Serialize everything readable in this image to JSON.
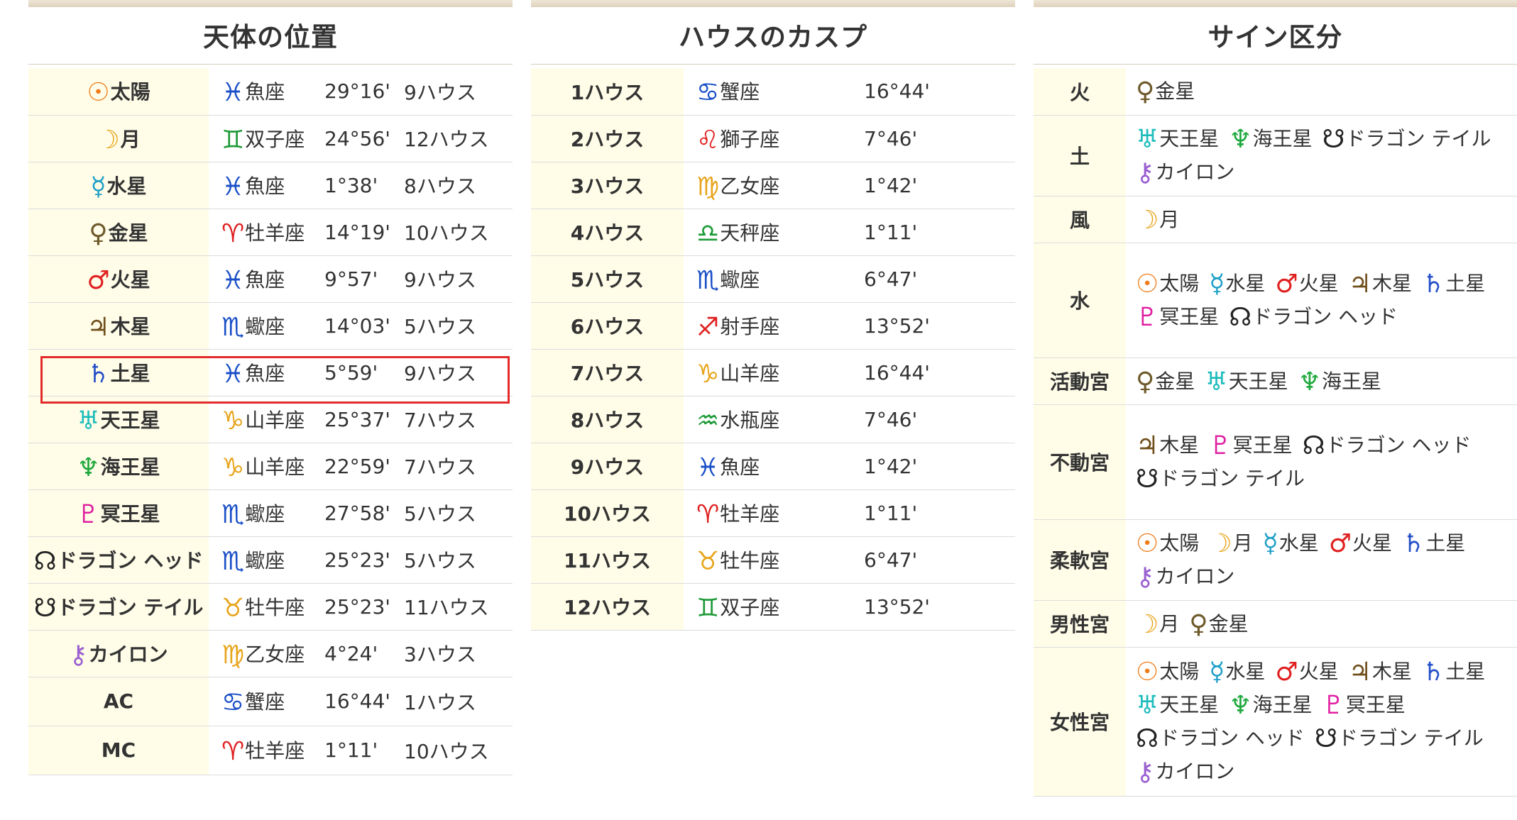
{
  "colors": {
    "sun": "#ef7d1a",
    "moon": "#e8a51d",
    "mercury": "#1e9fc7",
    "venus": "#6e5a2a",
    "mars": "#e02020",
    "jupiter": "#6f4e1a",
    "saturn": "#2450c8",
    "uranus": "#1ebcbc",
    "neptune": "#1ea83c",
    "pluto": "#e01ea0",
    "node": "#222222",
    "chiron": "#9a5fd0",
    "water": "#1a4fc7",
    "earth": "#e8a51d",
    "fire": "#e02020",
    "air": "#1e9a38",
    "label_bg": "#fffde8"
  },
  "positions": {
    "title": "天体の位置",
    "rows": [
      {
        "sym": "☉",
        "sym_icon": "sun-icon",
        "sym_color": "#ef7d1a",
        "label": "太陽",
        "sign_sym": "♓",
        "sign_icon": "pisces-icon",
        "sign_color": "#1a4fc7",
        "sign": "魚座",
        "deg": "29°16'",
        "house": "9ハウス"
      },
      {
        "sym": "☽",
        "sym_icon": "moon-icon",
        "sym_color": "#e8a51d",
        "label": "月",
        "sign_sym": "♊",
        "sign_icon": "gemini-icon",
        "sign_color": "#1e9a38",
        "sign": "双子座",
        "deg": "24°56'",
        "house": "12ハウス"
      },
      {
        "sym": "☿",
        "sym_icon": "mercury-icon",
        "sym_color": "#1e9fc7",
        "label": "水星",
        "sign_sym": "♓",
        "sign_icon": "pisces-icon",
        "sign_color": "#1a4fc7",
        "sign": "魚座",
        "deg": "1°38'",
        "house": "8ハウス"
      },
      {
        "sym": "♀",
        "sym_icon": "venus-icon",
        "sym_color": "#6e5a2a",
        "label": "金星",
        "sign_sym": "♈",
        "sign_icon": "aries-icon",
        "sign_color": "#e02020",
        "sign": "牡羊座",
        "deg": "14°19'",
        "house": "10ハウス"
      },
      {
        "sym": "♂",
        "sym_icon": "mars-icon",
        "sym_color": "#e02020",
        "label": "火星",
        "sign_sym": "♓",
        "sign_icon": "pisces-icon",
        "sign_color": "#1a4fc7",
        "sign": "魚座",
        "deg": "9°57'",
        "house": "9ハウス"
      },
      {
        "sym": "♃",
        "sym_icon": "jupiter-icon",
        "sym_color": "#6f4e1a",
        "label": "木星",
        "sign_sym": "♏",
        "sign_icon": "scorpio-icon",
        "sign_color": "#1a4fc7",
        "sign": "蠍座",
        "deg": "14°03'",
        "house": "5ハウス"
      },
      {
        "sym": "♄",
        "sym_icon": "saturn-icon",
        "sym_color": "#2450c8",
        "label": "土星",
        "sign_sym": "♓",
        "sign_icon": "pisces-icon",
        "sign_color": "#1a4fc7",
        "sign": "魚座",
        "deg": "5°59'",
        "house": "9ハウス"
      },
      {
        "sym": "♅",
        "sym_icon": "uranus-icon",
        "sym_color": "#1ebcbc",
        "label": "天王星",
        "sign_sym": "♑",
        "sign_icon": "capricorn-icon",
        "sign_color": "#e8a51d",
        "sign": "山羊座",
        "deg": "25°37'",
        "house": "7ハウス"
      },
      {
        "sym": "♆",
        "sym_icon": "neptune-icon",
        "sym_color": "#1ea83c",
        "label": "海王星",
        "sign_sym": "♑",
        "sign_icon": "capricorn-icon",
        "sign_color": "#e8a51d",
        "sign": "山羊座",
        "deg": "22°59'",
        "house": "7ハウス"
      },
      {
        "sym": "♇",
        "sym_icon": "pluto-icon",
        "sym_color": "#e01ea0",
        "label": "冥王星",
        "sign_sym": "♏",
        "sign_icon": "scorpio-icon",
        "sign_color": "#1a4fc7",
        "sign": "蠍座",
        "deg": "27°58'",
        "house": "5ハウス"
      },
      {
        "sym": "☊",
        "sym_icon": "dragon-head-icon",
        "sym_color": "#222222",
        "label": "ドラゴン ヘッド",
        "sign_sym": "♏",
        "sign_icon": "scorpio-icon",
        "sign_color": "#1a4fc7",
        "sign": "蠍座",
        "deg": "25°23'",
        "house": "5ハウス"
      },
      {
        "sym": "☋",
        "sym_icon": "dragon-tail-icon",
        "sym_color": "#222222",
        "label": "ドラゴン テイル",
        "sign_sym": "♉",
        "sign_icon": "taurus-icon",
        "sign_color": "#e8a51d",
        "sign": "牡牛座",
        "deg": "25°23'",
        "house": "11ハウス"
      },
      {
        "sym": "⚷",
        "sym_icon": "chiron-icon",
        "sym_color": "#9a5fd0",
        "label": "カイロン",
        "sign_sym": "♍",
        "sign_icon": "virgo-icon",
        "sign_color": "#e8a51d",
        "sign": "乙女座",
        "deg": "4°24'",
        "house": "3ハウス"
      },
      {
        "sym": "",
        "sym_icon": "",
        "sym_color": "#333333",
        "label": "AC",
        "sign_sym": "♋",
        "sign_icon": "cancer-icon",
        "sign_color": "#1a4fc7",
        "sign": "蟹座",
        "deg": "16°44'",
        "house": "1ハウス"
      },
      {
        "sym": "",
        "sym_icon": "",
        "sym_color": "#333333",
        "label": "MC",
        "sign_sym": "♈",
        "sign_icon": "aries-icon",
        "sign_color": "#e02020",
        "sign": "牡羊座",
        "deg": "1°11'",
        "house": "10ハウス"
      }
    ]
  },
  "cusps": {
    "title": "ハウスのカスプ",
    "rows": [
      {
        "label": "1ハウス",
        "sign_sym": "♋",
        "sign_icon": "cancer-icon",
        "sign_color": "#1a4fc7",
        "sign": "蟹座",
        "deg": "16°44'"
      },
      {
        "label": "2ハウス",
        "sign_sym": "♌",
        "sign_icon": "leo-icon",
        "sign_color": "#e02020",
        "sign": "獅子座",
        "deg": "7°46'"
      },
      {
        "label": "3ハウス",
        "sign_sym": "♍",
        "sign_icon": "virgo-icon",
        "sign_color": "#e8a51d",
        "sign": "乙女座",
        "deg": "1°42'"
      },
      {
        "label": "4ハウス",
        "sign_sym": "♎",
        "sign_icon": "libra-icon",
        "sign_color": "#1e9a38",
        "sign": "天秤座",
        "deg": "1°11'"
      },
      {
        "label": "5ハウス",
        "sign_sym": "♏",
        "sign_icon": "scorpio-icon",
        "sign_color": "#1a4fc7",
        "sign": "蠍座",
        "deg": "6°47'"
      },
      {
        "label": "6ハウス",
        "sign_sym": "♐",
        "sign_icon": "sagittarius-icon",
        "sign_color": "#e02020",
        "sign": "射手座",
        "deg": "13°52'"
      },
      {
        "label": "7ハウス",
        "sign_sym": "♑",
        "sign_icon": "capricorn-icon",
        "sign_color": "#e8a51d",
        "sign": "山羊座",
        "deg": "16°44'"
      },
      {
        "label": "8ハウス",
        "sign_sym": "♒",
        "sign_icon": "aquarius-icon",
        "sign_color": "#1e9a38",
        "sign": "水瓶座",
        "deg": "7°46'"
      },
      {
        "label": "9ハウス",
        "sign_sym": "♓",
        "sign_icon": "pisces-icon",
        "sign_color": "#1a4fc7",
        "sign": "魚座",
        "deg": "1°42'"
      },
      {
        "label": "10ハウス",
        "sign_sym": "♈",
        "sign_icon": "aries-icon",
        "sign_color": "#e02020",
        "sign": "牡羊座",
        "deg": "1°11'"
      },
      {
        "label": "11ハウス",
        "sign_sym": "♉",
        "sign_icon": "taurus-icon",
        "sign_color": "#e8a51d",
        "sign": "牡牛座",
        "deg": "6°47'"
      },
      {
        "label": "12ハウス",
        "sign_sym": "♊",
        "sign_icon": "gemini-icon",
        "sign_color": "#1e9a38",
        "sign": "双子座",
        "deg": "13°52'"
      }
    ]
  },
  "signs": {
    "title": "サイン区分",
    "rows": [
      {
        "label": "火",
        "items": [
          {
            "sym": "♀",
            "icon": "venus-icon",
            "color": "#6e5a2a",
            "name": "金星"
          }
        ]
      },
      {
        "label": "土",
        "items": [
          {
            "sym": "♅",
            "icon": "uranus-icon",
            "color": "#1ebcbc",
            "name": "天王星"
          },
          {
            "sym": "♆",
            "icon": "neptune-icon",
            "color": "#1ea83c",
            "name": "海王星"
          },
          {
            "sym": "☋",
            "icon": "dragon-tail-icon",
            "color": "#222222",
            "name": "ドラゴン テイル"
          },
          {
            "sym": "⚷",
            "icon": "chiron-icon",
            "color": "#9a5fd0",
            "name": "カイロン"
          }
        ]
      },
      {
        "label": "風",
        "items": [
          {
            "sym": "☽",
            "icon": "moon-icon",
            "color": "#e8a51d",
            "name": "月"
          }
        ]
      },
      {
        "label": "水",
        "items": [
          {
            "sym": "☉",
            "icon": "sun-icon",
            "color": "#ef7d1a",
            "name": "太陽"
          },
          {
            "sym": "☿",
            "icon": "mercury-icon",
            "color": "#1e9fc7",
            "name": "水星"
          },
          {
            "sym": "♂",
            "icon": "mars-icon",
            "color": "#e02020",
            "name": "火星"
          },
          {
            "sym": "♃",
            "icon": "jupiter-icon",
            "color": "#6f4e1a",
            "name": "木星"
          },
          {
            "sym": "♄",
            "icon": "saturn-icon",
            "color": "#2450c8",
            "name": "土星"
          },
          {
            "sym": "♇",
            "icon": "pluto-icon",
            "color": "#e01ea0",
            "name": "冥王星"
          },
          {
            "sym": "☊",
            "icon": "dragon-head-icon",
            "color": "#222222",
            "name": "ドラゴン ヘッド"
          }
        ]
      },
      {
        "label": "活動宮",
        "items": [
          {
            "sym": "♀",
            "icon": "venus-icon",
            "color": "#6e5a2a",
            "name": "金星"
          },
          {
            "sym": "♅",
            "icon": "uranus-icon",
            "color": "#1ebcbc",
            "name": "天王星"
          },
          {
            "sym": "♆",
            "icon": "neptune-icon",
            "color": "#1ea83c",
            "name": "海王星"
          }
        ]
      },
      {
        "label": "不動宮",
        "items": [
          {
            "sym": "♃",
            "icon": "jupiter-icon",
            "color": "#6f4e1a",
            "name": "木星"
          },
          {
            "sym": "♇",
            "icon": "pluto-icon",
            "color": "#e01ea0",
            "name": "冥王星"
          },
          {
            "sym": "☊",
            "icon": "dragon-head-icon",
            "color": "#222222",
            "name": "ドラゴン ヘッド"
          },
          {
            "sym": "☋",
            "icon": "dragon-tail-icon",
            "color": "#222222",
            "name": "ドラゴン テイル"
          }
        ]
      },
      {
        "label": "柔軟宮",
        "items": [
          {
            "sym": "☉",
            "icon": "sun-icon",
            "color": "#ef7d1a",
            "name": "太陽"
          },
          {
            "sym": "☽",
            "icon": "moon-icon",
            "color": "#e8a51d",
            "name": "月"
          },
          {
            "sym": "☿",
            "icon": "mercury-icon",
            "color": "#1e9fc7",
            "name": "水星"
          },
          {
            "sym": "♂",
            "icon": "mars-icon",
            "color": "#e02020",
            "name": "火星"
          },
          {
            "sym": "♄",
            "icon": "saturn-icon",
            "color": "#2450c8",
            "name": "土星"
          },
          {
            "sym": "⚷",
            "icon": "chiron-icon",
            "color": "#9a5fd0",
            "name": "カイロン"
          }
        ]
      },
      {
        "label": "男性宮",
        "items": [
          {
            "sym": "☽",
            "icon": "moon-icon",
            "color": "#e8a51d",
            "name": "月"
          },
          {
            "sym": "♀",
            "icon": "venus-icon",
            "color": "#6e5a2a",
            "name": "金星"
          }
        ]
      },
      {
        "label": "女性宮",
        "items": [
          {
            "sym": "☉",
            "icon": "sun-icon",
            "color": "#ef7d1a",
            "name": "太陽"
          },
          {
            "sym": "☿",
            "icon": "mercury-icon",
            "color": "#1e9fc7",
            "name": "水星"
          },
          {
            "sym": "♂",
            "icon": "mars-icon",
            "color": "#e02020",
            "name": "火星"
          },
          {
            "sym": "♃",
            "icon": "jupiter-icon",
            "color": "#6f4e1a",
            "name": "木星"
          },
          {
            "sym": "♄",
            "icon": "saturn-icon",
            "color": "#2450c8",
            "name": "土星"
          },
          {
            "sym": "♅",
            "icon": "uranus-icon",
            "color": "#1ebcbc",
            "name": "天王星"
          },
          {
            "sym": "♆",
            "icon": "neptune-icon",
            "color": "#1ea83c",
            "name": "海王星"
          },
          {
            "sym": "♇",
            "icon": "pluto-icon",
            "color": "#e01ea0",
            "name": "冥王星"
          },
          {
            "sym": "☊",
            "icon": "dragon-head-icon",
            "color": "#222222",
            "name": "ドラゴン ヘッド"
          },
          {
            "sym": "☋",
            "icon": "dragon-tail-icon",
            "color": "#222222",
            "name": "ドラゴン テイル"
          },
          {
            "sym": "⚷",
            "icon": "chiron-icon",
            "color": "#9a5fd0",
            "name": "カイロン"
          }
        ]
      }
    ]
  }
}
